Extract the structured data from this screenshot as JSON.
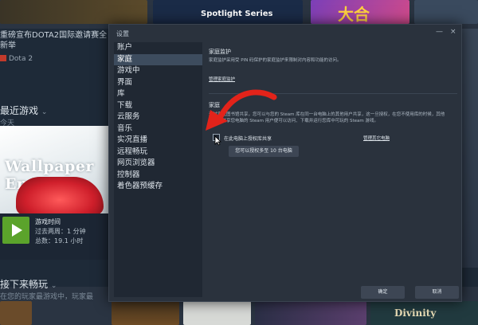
{
  "background": {
    "top_banner": "Spotlight Series",
    "top_banner_right": "大合",
    "news_title": "重磅宣布DOTA2国际邀请赛全新举",
    "news_tag": "Dota 2",
    "recent_games_header": "最近游戏",
    "recent_games_sub": "今天",
    "featured_game": "Wallpaper Eng",
    "playtime_label": "游戏时间",
    "playtime_recent": "过去两周：1 分钟",
    "playtime_total": "总数：19.1 小时",
    "play_next_header": "接下来畅玩",
    "play_next_sub": "在您的玩家最游戏中，玩家最",
    "bottom_tile_text": "Divinity"
  },
  "dialog": {
    "title": "设置",
    "controls": {
      "minimize": "—",
      "close": "×"
    },
    "nav": [
      "账户",
      "家庭",
      "游戏中",
      "界面",
      "库",
      "下载",
      "云服务",
      "音乐",
      "实况直播",
      "远程畅玩",
      "网页浏览器",
      "控制器",
      "着色器预缓存"
    ],
    "active_nav": 1,
    "family_view": {
      "heading": "家庭监护",
      "desc": "家庭监护采用受 PIN 码保护的家庭监护来限制对内容和功能的访问。",
      "manage_link": "管理家庭监护"
    },
    "family_share": {
      "heading": "家庭",
      "desc": "通过家庭图书馆共享，您可以与您的 Steam 库在同一台电脑上的其他用户共享，这一旦授权，在您不使用库的时候，其他已授权共享您电脑的 Steam 用户便可以访问、下载并运行您库中可玩的 Steam 游戏。",
      "authorize_label": "在此电脑上授权库共享",
      "authorize_checked": false,
      "manage_other_link": "管理其它电脑",
      "capacity_button": "您可以授权多至 10 台电脑"
    },
    "footer": {
      "ok": "确定",
      "cancel": "取消"
    }
  }
}
